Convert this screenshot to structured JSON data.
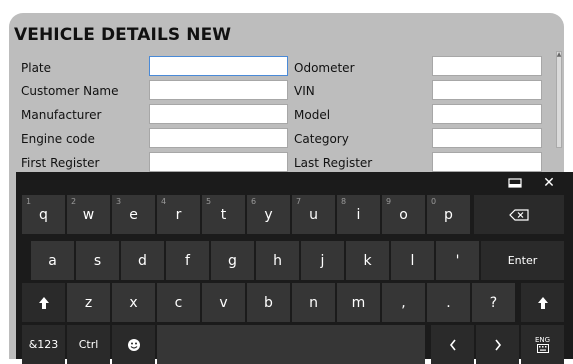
{
  "form": {
    "title": "VEHICLE DETAILS NEW",
    "left_fields": [
      {
        "label": "Plate",
        "value": ""
      },
      {
        "label": "Customer Name",
        "value": ""
      },
      {
        "label": "Manufacturer",
        "value": ""
      },
      {
        "label": "Engine code",
        "value": ""
      },
      {
        "label": "First Register",
        "value": ""
      }
    ],
    "right_fields": [
      {
        "label": "Odometer",
        "value": ""
      },
      {
        "label": "VIN",
        "value": ""
      },
      {
        "label": "Model",
        "value": ""
      },
      {
        "label": "Category",
        "value": ""
      },
      {
        "label": "Last Register",
        "value": ""
      }
    ]
  },
  "keyboard": {
    "window_buttons": {
      "minimize_icon": "minimize-icon",
      "close": "✕"
    },
    "row1": [
      {
        "label": "q",
        "num": "1"
      },
      {
        "label": "w",
        "num": "2"
      },
      {
        "label": "e",
        "num": "3"
      },
      {
        "label": "r",
        "num": "4"
      },
      {
        "label": "t",
        "num": "5"
      },
      {
        "label": "y",
        "num": "6"
      },
      {
        "label": "u",
        "num": "7"
      },
      {
        "label": "i",
        "num": "8"
      },
      {
        "label": "o",
        "num": "9"
      },
      {
        "label": "p",
        "num": "0"
      }
    ],
    "row2": [
      "a",
      "s",
      "d",
      "f",
      "g",
      "h",
      "j",
      "k",
      "l",
      "'"
    ],
    "enter": "Enter",
    "row3": [
      "z",
      "x",
      "c",
      "v",
      "b",
      "n",
      "m",
      ",",
      ".",
      "?"
    ],
    "symbols": "&123",
    "ctrl": "Ctrl",
    "lang": "ENG"
  }
}
